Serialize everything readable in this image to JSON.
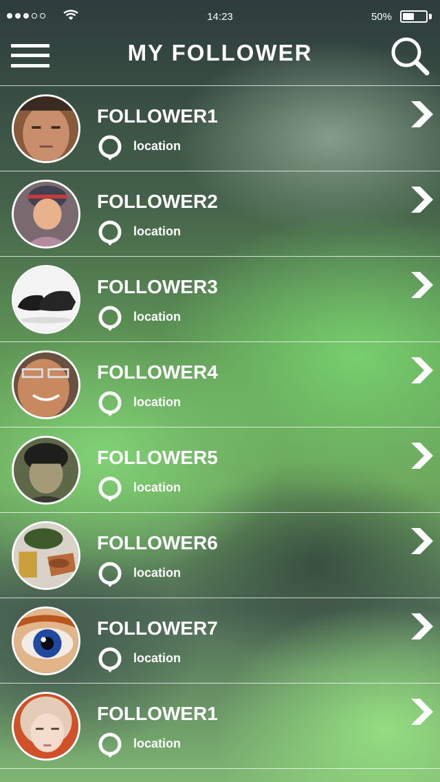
{
  "status": {
    "time": "14:23",
    "battery": "50%",
    "battery_level": 0.5
  },
  "nav": {
    "title": "MY FOLLOWER"
  },
  "followers": [
    {
      "name": "FOLLOWER1",
      "location": "location"
    },
    {
      "name": "FOLLOWER2",
      "location": "location"
    },
    {
      "name": "FOLLOWER3",
      "location": "location"
    },
    {
      "name": "FOLLOWER4",
      "location": "location"
    },
    {
      "name": "FOLLOWER5",
      "location": "location"
    },
    {
      "name": "FOLLOWER6",
      "location": "location"
    },
    {
      "name": "FOLLOWER7",
      "location": "location"
    },
    {
      "name": "FOLLOWER1",
      "location": "location"
    }
  ],
  "icons": {
    "menu": "hamburger-menu-icon",
    "search": "search-icon",
    "location": "location-pin-icon",
    "chevron": "chevron-right-icon"
  }
}
